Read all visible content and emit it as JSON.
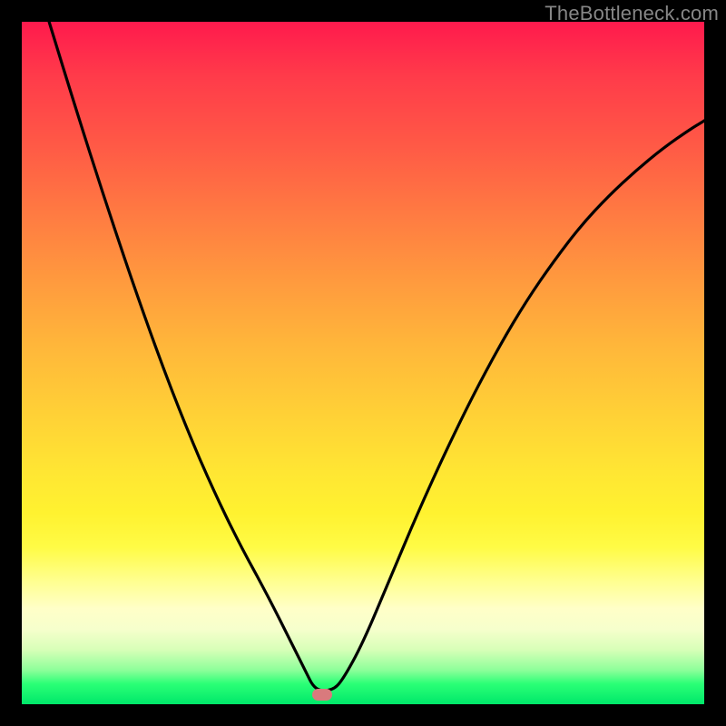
{
  "watermark": "TheBottleneck.com",
  "marker": {
    "x_frac": 0.44,
    "y_frac": 0.985
  },
  "chart_data": {
    "type": "line",
    "title": "",
    "xlabel": "",
    "ylabel": "",
    "xlim": [
      0,
      1
    ],
    "ylim": [
      0,
      1
    ],
    "series": [
      {
        "name": "curve",
        "x": [
          0.04,
          0.08,
          0.12,
          0.16,
          0.2,
          0.24,
          0.28,
          0.32,
          0.36,
          0.395,
          0.415,
          0.43,
          0.455,
          0.47,
          0.5,
          0.54,
          0.58,
          0.62,
          0.66,
          0.7,
          0.74,
          0.78,
          0.82,
          0.86,
          0.9,
          0.94,
          0.98,
          1.0
        ],
        "y": [
          1.0,
          0.87,
          0.745,
          0.625,
          0.512,
          0.408,
          0.315,
          0.233,
          0.16,
          0.09,
          0.05,
          0.02,
          0.02,
          0.035,
          0.09,
          0.185,
          0.28,
          0.368,
          0.45,
          0.525,
          0.592,
          0.65,
          0.702,
          0.745,
          0.782,
          0.815,
          0.843,
          0.855
        ]
      }
    ],
    "annotations": [
      {
        "type": "marker",
        "shape": "pill",
        "color": "#d97a7d",
        "x": 0.44,
        "y": 0.015
      }
    ],
    "background_gradient": {
      "direction": "vertical",
      "stops": [
        {
          "pos": 0.0,
          "color": "#ff1a4d"
        },
        {
          "pos": 0.5,
          "color": "#ffb83a"
        },
        {
          "pos": 0.8,
          "color": "#fffb45"
        },
        {
          "pos": 1.0,
          "color": "#00e86a"
        }
      ]
    }
  }
}
